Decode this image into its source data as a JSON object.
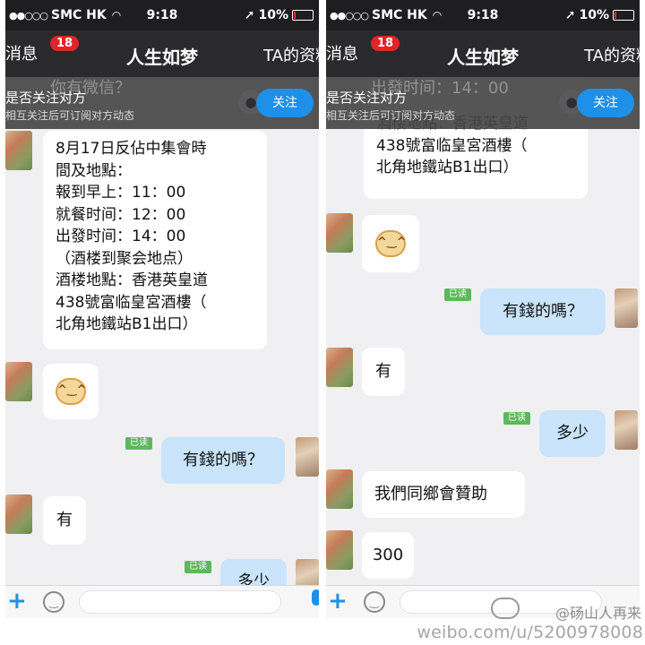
{
  "status": {
    "carrier": "SMC HK",
    "time": "9:18",
    "battery": "10%"
  },
  "nav": {
    "back_label": "消息",
    "badge": "18",
    "title": "人生如梦",
    "profile_label": "TA的资料"
  },
  "banner": {
    "ghost_text_left": "你有微信？",
    "ghost_text_right": "出發时间：14：00",
    "title": "是否关注对方",
    "subtitle": "相互关注后可订阅对方动态",
    "follow_button": "关注"
  },
  "left_messages": {
    "details": "8月17日反佔中集會時\n間及地點：\n報到早上：11：00\n就餐时间：12：00\n出發时间：14：00\n（酒楼到聚会地点）\n酒楼地點：香港英皇道\n438號富临皇宮酒樓（\n北角地鐵站B1出口）",
    "read_tag": "已读",
    "msg_money": "有錢的嗎？",
    "msg_yes": "有",
    "msg_howmuch": "多少"
  },
  "right_messages": {
    "details_tail": "酒楼地點：香港英皇道\n438號富临皇宮酒樓（\n北角地鐵站B1出口）",
    "read_tag": "已读",
    "msg_money": "有錢的嗎？",
    "msg_yes": "有",
    "msg_howmuch": "多少",
    "msg_sponsor": "我們同鄉會贊助",
    "msg_amount": "300"
  },
  "watermark": {
    "name": "@砀山人再来",
    "url": "weibo.com/u/5200978008"
  },
  "colors": {
    "nav_bg": "#2a2a2d",
    "follow_blue": "#1e90e8",
    "outgoing_bubble": "#c9e4fb",
    "read_tag_green": "#5db85c",
    "badge_red": "#e1242c"
  },
  "icons": [
    "wifi-icon",
    "location-arrow-icon",
    "battery-icon",
    "chevron-left-icon",
    "plus-icon",
    "smiley-icon",
    "microphone-icon",
    "weibo-logo-icon",
    "smiling-face-sticker"
  ]
}
